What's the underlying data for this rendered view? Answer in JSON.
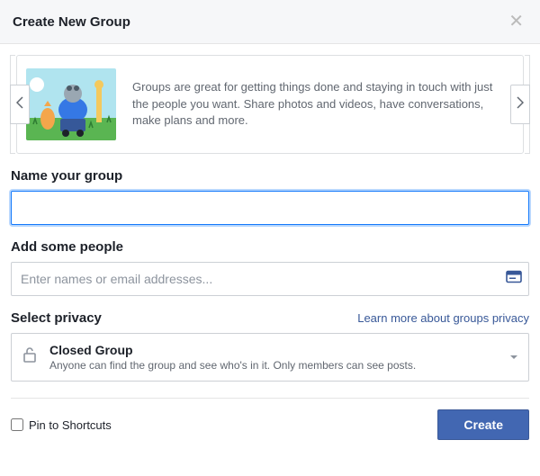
{
  "header": {
    "title": "Create New Group"
  },
  "banner": {
    "text": "Groups are great for getting things done and staying in touch with just the people you want. Share photos and videos, have conversations, make plans and more."
  },
  "labels": {
    "name": "Name your group",
    "people": "Add some people",
    "privacy": "Select privacy"
  },
  "people": {
    "placeholder": "Enter names or email addresses..."
  },
  "privacy": {
    "link": "Learn more about groups privacy",
    "selected": {
      "title": "Closed Group",
      "desc": "Anyone can find the group and see who's in it. Only members can see posts."
    }
  },
  "footer": {
    "pin_label": "Pin to Shortcuts",
    "create_label": "Create"
  },
  "icons": {
    "close": "close-icon",
    "contact": "contact-card-icon",
    "lock": "unlock-icon"
  },
  "colors": {
    "primary": "#4267b2",
    "link": "#385898",
    "focus": "#1479fb"
  }
}
